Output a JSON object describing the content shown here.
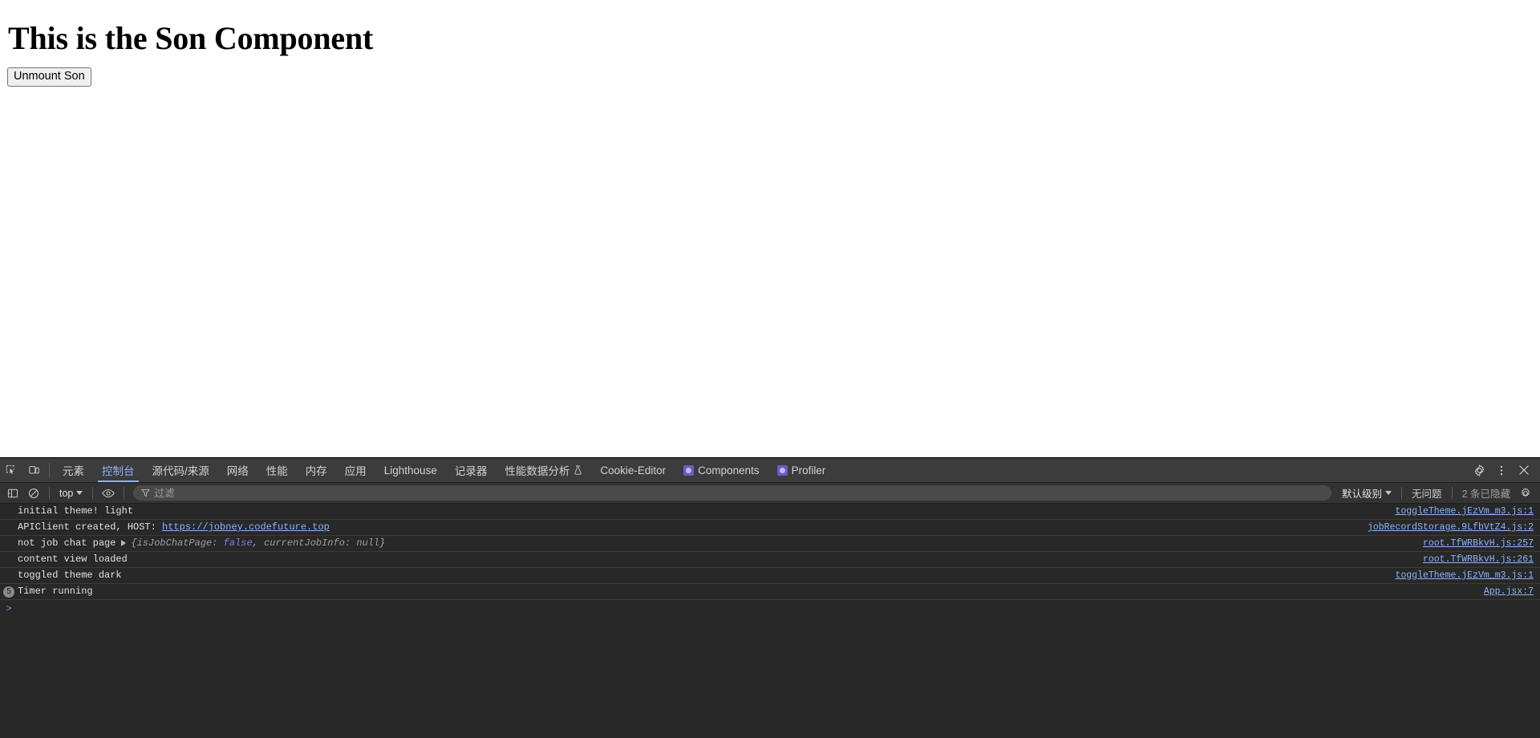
{
  "page": {
    "heading": "This is the Son Component",
    "unmount_button": "Unmount Son"
  },
  "devtools": {
    "tabs": [
      {
        "label": "元素",
        "active": false,
        "icon": null
      },
      {
        "label": "控制台",
        "active": true,
        "icon": null
      },
      {
        "label": "源代码/来源",
        "active": false,
        "icon": null
      },
      {
        "label": "网络",
        "active": false,
        "icon": null
      },
      {
        "label": "性能",
        "active": false,
        "icon": null
      },
      {
        "label": "内存",
        "active": false,
        "icon": null
      },
      {
        "label": "应用",
        "active": false,
        "icon": null
      },
      {
        "label": "Lighthouse",
        "active": false,
        "icon": null
      },
      {
        "label": "记录器",
        "active": false,
        "icon": null
      },
      {
        "label": "性能数据分析",
        "active": false,
        "icon": "flask-icon"
      },
      {
        "label": "Cookie-Editor",
        "active": false,
        "icon": null
      },
      {
        "label": "Components",
        "active": false,
        "icon": "react-extension-icon"
      },
      {
        "label": "Profiler",
        "active": false,
        "icon": "react-extension-icon"
      }
    ],
    "toolbar_icons": {
      "inspect": "inspect-element-icon",
      "device": "device-toolbar-icon",
      "settings": "gear-icon",
      "more": "more-vertical-icon",
      "close": "close-icon"
    },
    "console_toolbar": {
      "sidebar_toggle": "console-sidebar-icon",
      "clear_console": "clear-console-icon",
      "context": "top",
      "live_expression": "eye-icon",
      "filter_placeholder": "过滤",
      "filter_value": "",
      "level": "默认级别",
      "issues": "无问题",
      "hidden_count": "2 条已隐藏",
      "settings": "gear-icon"
    },
    "messages": [
      {
        "text": "initial theme! light",
        "link": "toggleTheme.jEzVm_m3.js:1",
        "count": null,
        "expandable": false
      },
      {
        "text": "APIClient created, HOST: ",
        "url": "https://jobney.codefuture.top",
        "link": "jobRecordStorage.9LfbVtZ4.js:2",
        "count": null,
        "expandable": false
      },
      {
        "text": "not job chat page",
        "object_preview": {
          "open": "{",
          "key1": "isJobChatPage:",
          "val1": "false",
          "comma": ", ",
          "key2": "currentJobInfo:",
          "val2": "null",
          "close": "}"
        },
        "link": "root.TfWRBkvH.js:257",
        "count": null,
        "expandable": true
      },
      {
        "text": "content view loaded",
        "link": "root.TfWRBkvH.js:261",
        "count": null,
        "expandable": false
      },
      {
        "text": "toggled theme dark",
        "link": "toggleTheme.jEzVm_m3.js:1",
        "count": null,
        "expandable": false
      },
      {
        "text": "Timer running",
        "link": "App.jsx:7",
        "count": "5",
        "expandable": false
      }
    ],
    "prompt": ">"
  },
  "colors": {
    "accent": "#8ab4f8",
    "panel_bg": "#282828",
    "tabbar_bg": "#3c3c3c",
    "toolbar_bg": "#333333",
    "extension_icon": "#6a5acd"
  }
}
